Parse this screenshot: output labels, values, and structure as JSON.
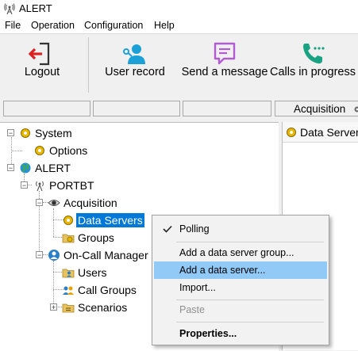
{
  "window": {
    "title": "ALERT"
  },
  "menu": [
    "File",
    "Operation",
    "Configuration",
    "Help"
  ],
  "toolbar": {
    "logout": "Logout",
    "user_record": "User record",
    "send_message": "Send a message",
    "calls": "Calls in progress"
  },
  "status": {
    "acquisition": "Acquisition"
  },
  "tree": {
    "system": "System",
    "options": "Options",
    "alert": "ALERT",
    "portbt": "PORTBT",
    "acquisition": "Acquisition",
    "data_servers": "Data Servers",
    "groups": "Groups",
    "oncall": "On-Call Manager",
    "users": "Users",
    "call_groups": "Call Groups",
    "scenarios": "Scenarios"
  },
  "right_panel": {
    "title": "Data Servers"
  },
  "context_menu": {
    "polling": "Polling",
    "add_group": "Add a data server group...",
    "add_server": "Add a data server...",
    "import": "Import...",
    "paste": "Paste",
    "properties": "Properties..."
  },
  "colors": {
    "selection": "#0078d7",
    "menu_hover": "#91c9f7",
    "logout_arrow": "#e02020",
    "user_icon": "#1ba0d7",
    "message_icon": "#b25cd1",
    "phone_icon": "#1aa383"
  }
}
